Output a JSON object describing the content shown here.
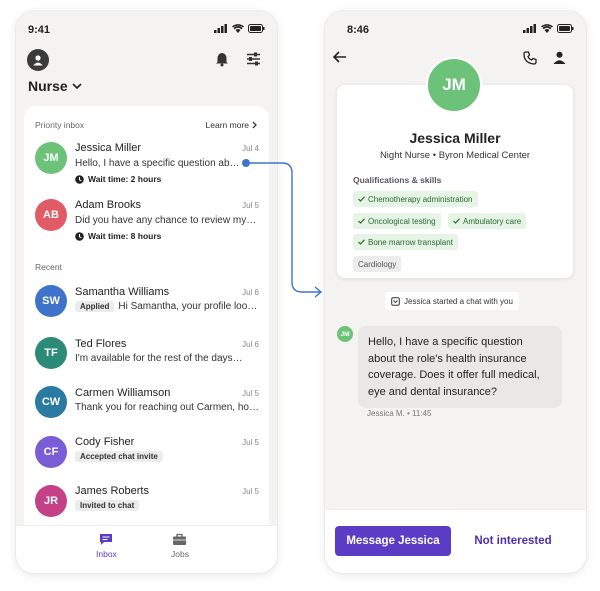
{
  "left": {
    "status_time": "9:41",
    "role": "Nurse",
    "priority_label": "Priority inbox",
    "learn_more": "Learn more",
    "recent_label": "Recent",
    "priority": [
      {
        "initials": "JM",
        "color": "#6dc27a",
        "name": "Jessica Miller",
        "date": "Jul 4",
        "message": "Hello, I have a specific question about…",
        "wait": "Wait time: 2 hours"
      },
      {
        "initials": "AB",
        "color": "#e15b66",
        "name": "Adam Brooks",
        "date": "Jul 5",
        "message": "Did you have any chance to review my…",
        "wait": "Wait time: 8 hours"
      }
    ],
    "recent": [
      {
        "initials": "SW",
        "color": "#3f73c9",
        "name": "Samantha Williams",
        "date": "Jul 6",
        "tag": "Applied",
        "message": "Hi Samantha, your profile looks…"
      },
      {
        "initials": "TF",
        "color": "#2c8b76",
        "name": "Ted Flores",
        "date": "Jul 6",
        "tag": "",
        "message": "I'm available for the rest of the days…"
      },
      {
        "initials": "CW",
        "color": "#2a7aa1",
        "name": "Carmen Williamson",
        "date": "Jul 5",
        "tag": "",
        "message": "Thank you for reaching out Carmen, how…"
      },
      {
        "initials": "CF",
        "color": "#7a5cd6",
        "name": "Cody Fisher",
        "date": "Jul 5",
        "tag": "Accepted chat invite",
        "message": ""
      },
      {
        "initials": "JR",
        "color": "#c44087",
        "name": "James Roberts",
        "date": "Jul 5",
        "tag": "Invited to chat",
        "message": ""
      }
    ],
    "tabs": {
      "inbox": "Inbox",
      "jobs": "Jobs"
    }
  },
  "right": {
    "status_time": "8:46",
    "initials": "JM",
    "name": "Jessica Miller",
    "role_line": "Night Nurse • Byron Medical Center",
    "qual_label": "Qualifications & skills",
    "skills": [
      "Chemotherapy administration",
      "Oncological testing",
      "Ambulatory care",
      "Bone marrow transplant"
    ],
    "other_skill": "Cardiology",
    "started": "Jessica started a chat with you",
    "bubble": "Hello, I have a specific question about the role's health insurance coverage. Does it offer full medical, eye and dental insurance?",
    "meta": "Jessica M.  •  11:45",
    "primary_btn": "Message Jessica",
    "secondary_btn": "Not interested"
  },
  "colors": {
    "accent": "#5b3cc4",
    "connector": "#3f73c9",
    "skill_bg": "#e5f4e5"
  }
}
